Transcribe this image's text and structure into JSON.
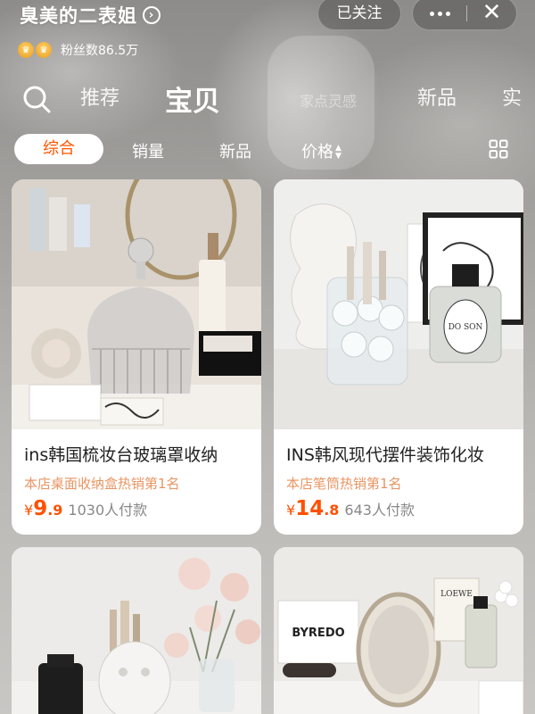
{
  "shop": {
    "name": "臭美的二表姐",
    "fans_label": "粉丝数86.5万",
    "follow_label": "已关注"
  },
  "tabs": {
    "search_icon": "search-icon",
    "recommend": "推荐",
    "items": "宝贝",
    "home_inspiration": "家点灵感",
    "new": "新品",
    "truncated": "实"
  },
  "filters": {
    "comprehensive": "综合",
    "sales": "销量",
    "new": "新品",
    "price": "价格"
  },
  "products": [
    {
      "title": "ins韩国梳妆台玻璃罩收纳",
      "rank": "本店桌面收纳盒热销第1名",
      "currency": "¥",
      "price_int": "9",
      "price_dec": ".9",
      "sold": "1030人付款"
    },
    {
      "title": "INS韩风现代摆件装饰化妆",
      "rank": "本店笔筒热销第1名",
      "currency": "¥",
      "price_int": "14",
      "price_dec": ".8",
      "sold": "643人付款"
    }
  ],
  "colors": {
    "accent": "#ff5500",
    "rank_text": "#e89563"
  }
}
